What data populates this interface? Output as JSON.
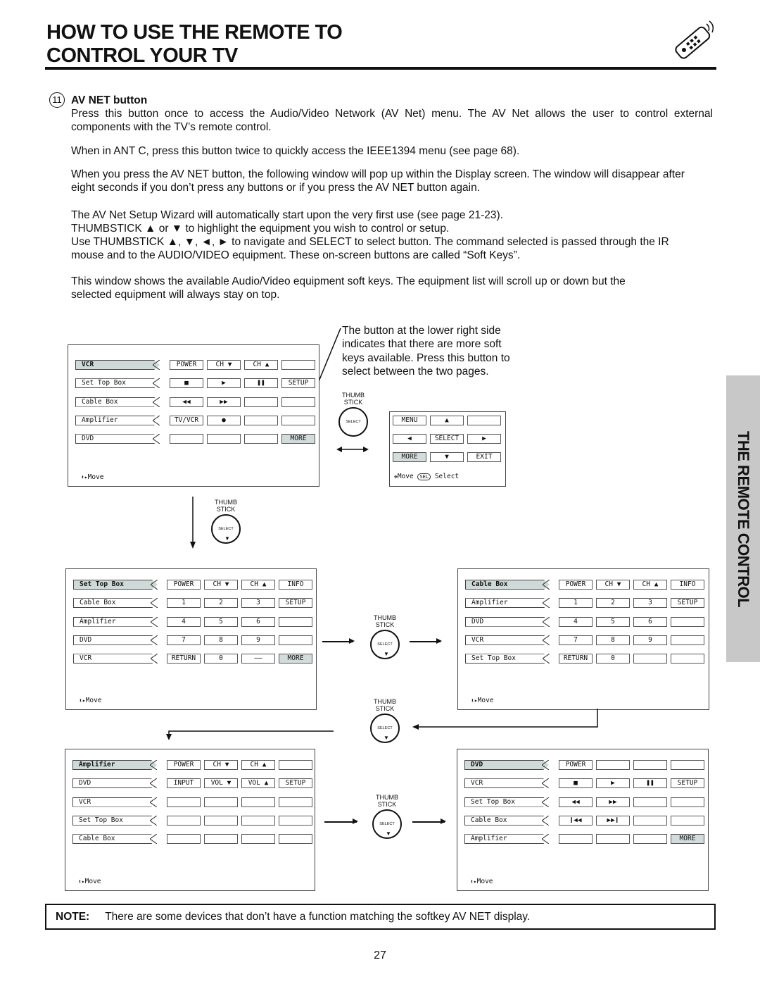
{
  "header": {
    "title_line1": "HOW TO USE THE REMOTE TO",
    "title_line2": "CONTROL YOUR TV",
    "icon": "remote-control-icon"
  },
  "section": {
    "number": "11",
    "heading": "AV NET button",
    "paragraphs": [
      "Press this button once to access the Audio/Video Network (AV Net) menu.  The AV Net allows the user to control external components with the TV’s remote control.",
      "When in ANT C, press this button twice to quickly access the IEEE1394 menu (see page 68).",
      "When you press the AV NET button, the following window will pop up within the Display screen.  The window will disappear after eight seconds if you don’t press any buttons or if you press the AV NET button again.",
      "The AV Net Setup Wizard will automatically start upon the very first use (see page 21-23).",
      "THUMBSTICK ▲ or ▼ to highlight the equipment you wish to control or setup.",
      "Use THUMBSTICK ▲, ▼, ◄, ► to navigate and SELECT to select button.  The command selected is passed through the IR mouse and to the AUDIO/VIDEO equipment.  These on-screen buttons are called “Soft Keys”.",
      "This window shows the available Audio/Video equipment soft keys.  The equipment list will scroll up or down but the selected equipment will always stay on top."
    ]
  },
  "callout": "The button at the lower right side indicates that there are more soft keys available.  Press this button to select between the two pages.",
  "thumbstick": {
    "label_top": "THUMB",
    "label_bottom": "STICK",
    "button": "SELECT"
  },
  "move_label": "Move",
  "panels": [
    {
      "rows": [
        [
          "VCR",
          "POWER",
          "CH ▼",
          "CH ▲",
          ""
        ],
        [
          "Set Top Box",
          "■",
          "▶",
          "❚❚",
          "SETUP"
        ],
        [
          "Cable Box",
          "◀◀",
          "▶▶",
          "",
          ""
        ],
        [
          "Amplifier",
          "TV/VCR",
          "●",
          "",
          ""
        ],
        [
          "DVD",
          "",
          "",
          "",
          "MORE"
        ]
      ]
    },
    {
      "rows": [
        [
          "Set Top Box",
          "POWER",
          "CH ▼",
          "CH ▲",
          "INFO"
        ],
        [
          "Cable Box",
          "1",
          "2",
          "3",
          "SETUP"
        ],
        [
          "Amplifier",
          "4",
          "5",
          "6",
          ""
        ],
        [
          "DVD",
          "7",
          "8",
          "9",
          ""
        ],
        [
          "VCR",
          "RETURN",
          "0",
          "——",
          "MORE"
        ]
      ]
    },
    {
      "rows": [
        [
          "Cable Box",
          "POWER",
          "CH ▼",
          "CH ▲",
          "INFO"
        ],
        [
          "Amplifier",
          "1",
          "2",
          "3",
          "SETUP"
        ],
        [
          "DVD",
          "4",
          "5",
          "6",
          ""
        ],
        [
          "VCR",
          "7",
          "8",
          "9",
          ""
        ],
        [
          "Set Top Box",
          "RETURN",
          "0",
          "",
          ""
        ]
      ]
    },
    {
      "rows": [
        [
          "Amplifier",
          "POWER",
          "CH ▼",
          "CH ▲",
          ""
        ],
        [
          "DVD",
          "INPUT",
          "VOL ▼",
          "VOL ▲",
          "SETUP"
        ],
        [
          "VCR",
          "",
          "",
          "",
          ""
        ],
        [
          "Set Top Box",
          "",
          "",
          "",
          ""
        ],
        [
          "Cable Box",
          "",
          "",
          "",
          ""
        ]
      ]
    },
    {
      "rows": [
        [
          "DVD",
          "POWER",
          "",
          "",
          ""
        ],
        [
          "VCR",
          "■",
          "▶",
          "❚❚",
          "SETUP"
        ],
        [
          "Set Top Box",
          "◀◀",
          "▶▶",
          "",
          ""
        ],
        [
          "Cable Box",
          "❙◀◀",
          "▶▶❙",
          "",
          ""
        ],
        [
          "Amplifier",
          "",
          "",
          "",
          "MORE"
        ]
      ]
    }
  ],
  "nav_panel": {
    "rows": [
      [
        "MENU",
        "▲",
        ""
      ],
      [
        "◀",
        "SELECT",
        "▶"
      ],
      [
        "MORE",
        "▼",
        "EXIT"
      ]
    ],
    "move": "Move",
    "sel_icon": "SEL",
    "select": "Select"
  },
  "side_tab": "THE REMOTE CONTROL",
  "note": {
    "label": "NOTE:",
    "text": "There are some devices that don’t have a function matching the softkey AV NET display."
  },
  "page_number": "27"
}
